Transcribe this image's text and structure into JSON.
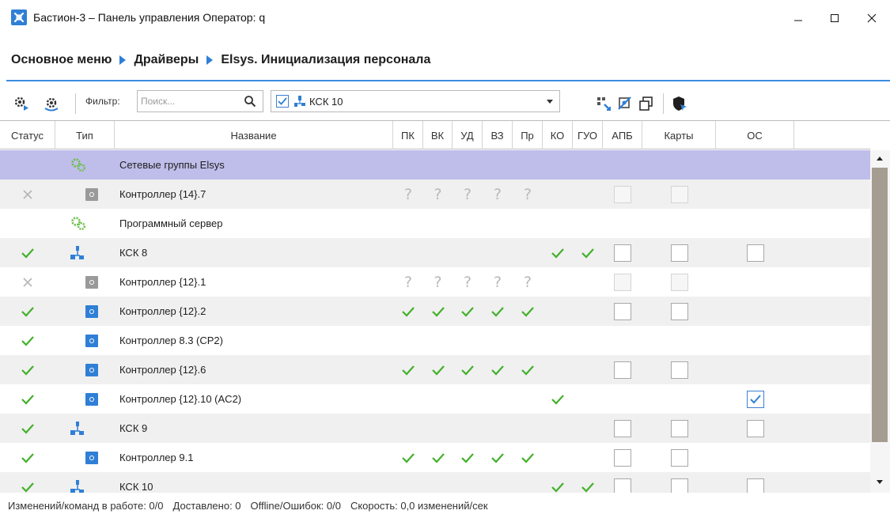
{
  "window": {
    "title": "Бастион-3 – Панель управления Оператор: q",
    "controls": {
      "minimize": "minimize-icon",
      "maximize": "maximize-icon",
      "close": "close-icon"
    }
  },
  "breadcrumb": [
    "Основное меню",
    "Драйверы",
    "Elsys. Инициализация персонала"
  ],
  "toolbar": {
    "filter_label": "Фильтр:",
    "search_placeholder": "Поиск...",
    "device_select": {
      "checked": true,
      "value": "КСК 10"
    },
    "icons": [
      "gears-play-icon",
      "gears-refresh-icon",
      "tree-expand-icon",
      "sync-icon",
      "copy-window-icon",
      "shield-icon"
    ]
  },
  "columns": [
    "Статус",
    "Тип",
    "Название",
    "ПК",
    "ВК",
    "УД",
    "ВЗ",
    "Пр",
    "КО",
    "ГУО",
    "АПБ",
    "Карты",
    "ОС"
  ],
  "rows": [
    {
      "status": "",
      "type": "group",
      "name": "Сетевые группы Elsys",
      "pk": "",
      "vk": "",
      "ud": "",
      "vz": "",
      "pr": "",
      "ko": "",
      "guo": "",
      "apb": "",
      "cards": "",
      "os": "",
      "selected": true
    },
    {
      "status": "cross",
      "type": "controller-gray",
      "name": "Контроллер {14}.7",
      "pk": "?",
      "vk": "?",
      "ud": "?",
      "vz": "?",
      "pr": "?",
      "ko": "",
      "guo": "",
      "apb": "disabled",
      "cards": "disabled",
      "os": ""
    },
    {
      "status": "",
      "type": "group",
      "name": "Программный сервер",
      "pk": "",
      "vk": "",
      "ud": "",
      "vz": "",
      "pr": "",
      "ko": "",
      "guo": "",
      "apb": "",
      "cards": "",
      "os": ""
    },
    {
      "status": "check",
      "type": "network",
      "name": "КСК 8",
      "pk": "",
      "vk": "",
      "ud": "",
      "vz": "",
      "pr": "",
      "ko": "check",
      "guo": "check",
      "apb": "empty",
      "cards": "empty",
      "os": "empty"
    },
    {
      "status": "cross",
      "type": "controller-gray",
      "name": "Контроллер {12}.1",
      "pk": "?",
      "vk": "?",
      "ud": "?",
      "vz": "?",
      "pr": "?",
      "ko": "",
      "guo": "",
      "apb": "disabled",
      "cards": "disabled",
      "os": ""
    },
    {
      "status": "check",
      "type": "controller",
      "name": "Контроллер {12}.2",
      "pk": "check",
      "vk": "check",
      "ud": "check",
      "vz": "check",
      "pr": "check",
      "ko": "",
      "guo": "",
      "apb": "empty",
      "cards": "empty",
      "os": ""
    },
    {
      "status": "check",
      "type": "controller",
      "name": "Контроллер 8.3 (CP2)",
      "pk": "",
      "vk": "",
      "ud": "",
      "vz": "",
      "pr": "",
      "ko": "",
      "guo": "",
      "apb": "",
      "cards": "",
      "os": ""
    },
    {
      "status": "check",
      "type": "controller",
      "name": "Контроллер {12}.6",
      "pk": "check",
      "vk": "check",
      "ud": "check",
      "vz": "check",
      "pr": "check",
      "ko": "",
      "guo": "",
      "apb": "empty",
      "cards": "empty",
      "os": ""
    },
    {
      "status": "check",
      "type": "controller",
      "name": "Контроллер {12}.10 (AC2)",
      "pk": "",
      "vk": "",
      "ud": "",
      "vz": "",
      "pr": "",
      "ko": "check",
      "guo": "",
      "apb": "",
      "cards": "",
      "os": "checked"
    },
    {
      "status": "check",
      "type": "network",
      "name": "КСК 9",
      "pk": "",
      "vk": "",
      "ud": "",
      "vz": "",
      "pr": "",
      "ko": "",
      "guo": "",
      "apb": "empty",
      "cards": "empty",
      "os": "empty"
    },
    {
      "status": "check",
      "type": "controller",
      "name": "Контроллер 9.1",
      "pk": "check",
      "vk": "check",
      "ud": "check",
      "vz": "check",
      "pr": "check",
      "ko": "",
      "guo": "",
      "apb": "empty",
      "cards": "empty",
      "os": ""
    },
    {
      "status": "check",
      "type": "network",
      "name": "КСК 10",
      "pk": "",
      "vk": "",
      "ud": "",
      "vz": "",
      "pr": "",
      "ko": "check",
      "guo": "check",
      "apb": "empty",
      "cards": "empty",
      "os": "empty"
    }
  ],
  "statusbar": {
    "changes": "Изменений/команд в работе: 0/0",
    "delivered": "Доставлено: 0",
    "offline": "Offline/Ошибок: 0/0",
    "speed": "Скорость: 0,0 изменений/сек"
  },
  "colors": {
    "accent": "#2f7fd6",
    "check": "#43b02a",
    "selected_row": "#bfbdea",
    "alt_row": "#f0f0f0",
    "group_gear": "#6cc04a",
    "controller_blue": "#2f7fd6",
    "controller_gray": "#9a9a9a"
  }
}
